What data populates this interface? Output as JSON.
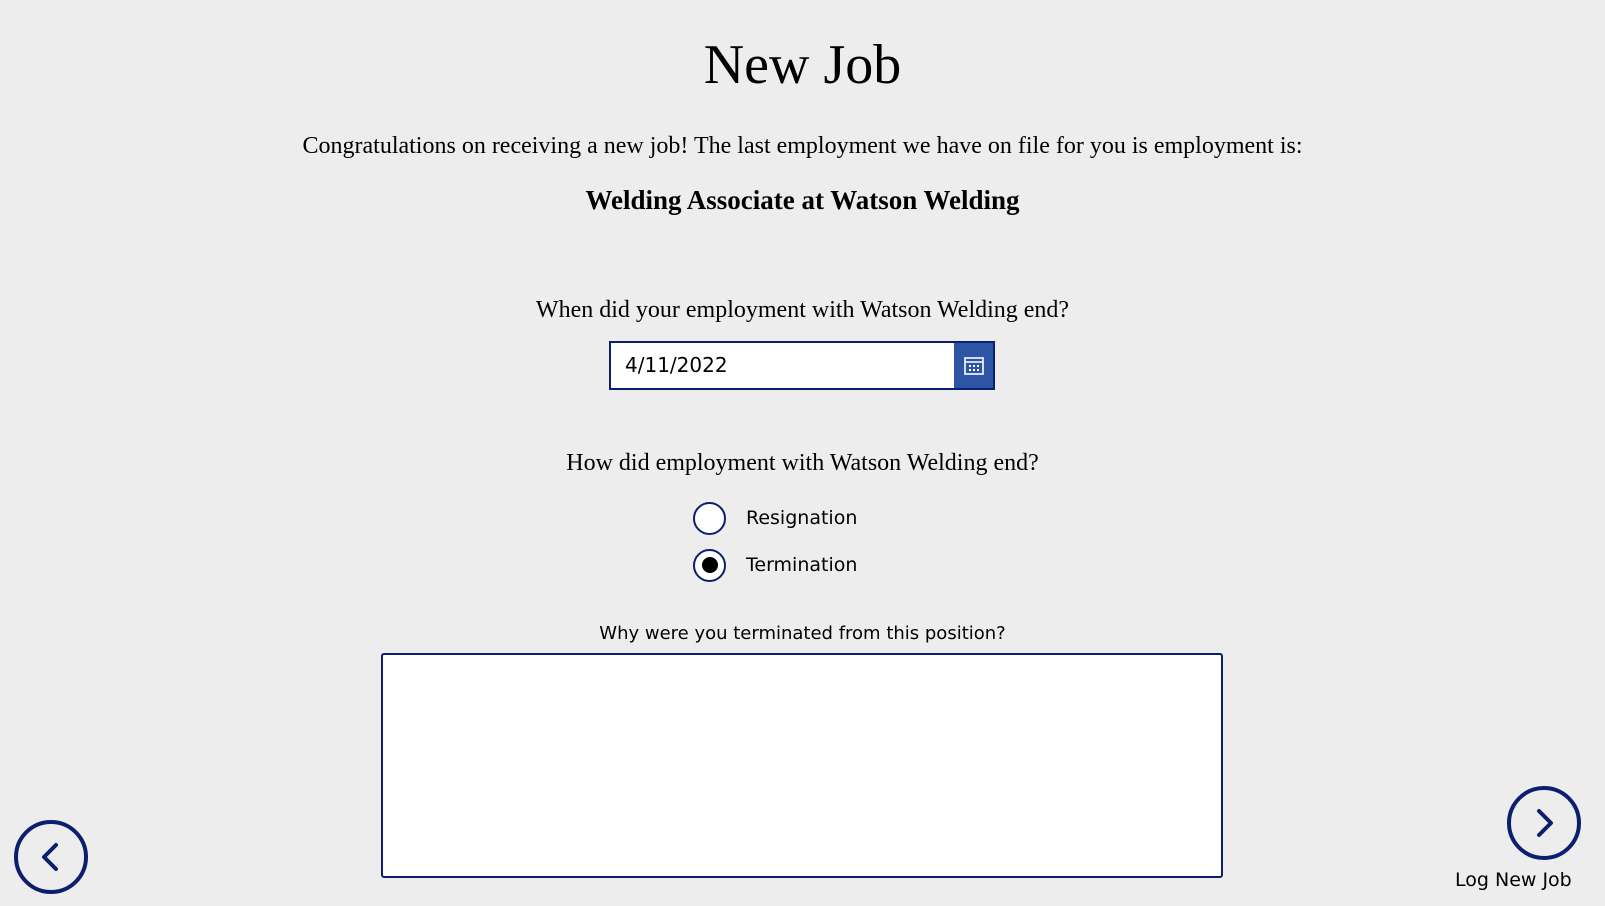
{
  "page": {
    "title": "New Job",
    "intro": "Congratulations on receiving a new job! The last employment we have on file for you is employment is:",
    "current_job": "Welding Associate at Watson Welding"
  },
  "end_date": {
    "question": "When did your employment with Watson Welding end?",
    "value": "4/11/2022",
    "button_icon": "calendar-icon"
  },
  "end_reason": {
    "question": "How did employment with Watson Welding end?",
    "options": [
      {
        "label": "Resignation",
        "selected": false
      },
      {
        "label": "Termination",
        "selected": true
      }
    ]
  },
  "termination": {
    "question": "Why were you terminated from this position?",
    "value": ""
  },
  "navigation": {
    "back_icon": "chevron-left-icon",
    "next_icon": "chevron-right-icon",
    "next_label": "Log New Job"
  },
  "colors": {
    "background": "#ededed",
    "border": "#0b1f6e",
    "calendar_button": "#2e55a5"
  }
}
